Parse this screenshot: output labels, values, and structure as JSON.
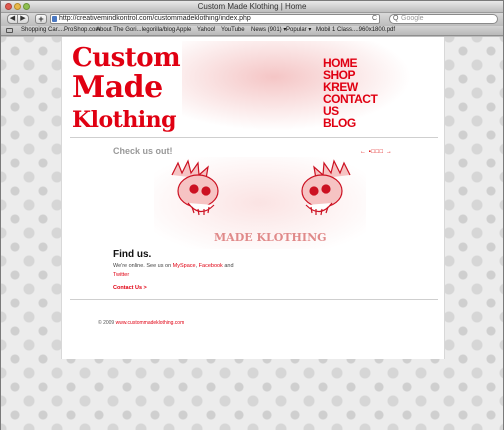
{
  "browser": {
    "window_title": "Custom Made Klothing | Home",
    "url": "http://creativemindkontrol.com/custommadeklothing/index.php",
    "search_placeholder": "Google",
    "back_label": "◀",
    "forward_label": "▶",
    "add_label": "+",
    "reload_label": "C",
    "search_icon": "Q",
    "bookmarks": [
      "Shopping Car....ProShop.com",
      "About The Gori...legorilla/blog",
      "Apple",
      "Yahoo!",
      "YouTube",
      "News (901) ▾",
      "Popular ▾",
      "Mobil 1 Class....960x1800.pdf"
    ]
  },
  "site": {
    "logo": {
      "line1": "Custom",
      "line2": "Made",
      "line3": "Klothing"
    },
    "nav": [
      "HOME",
      "SHOP",
      "KREW",
      "CONTACT",
      "US",
      "BLOG"
    ],
    "featured": {
      "heading": "Check us out!",
      "slider_controls": "←  ▪□□□  →",
      "banner_text": "MADE KLOTHING"
    },
    "find_us": {
      "heading": "Find us.",
      "text_prefix": "We're online. See us on",
      "myspace": "MySpace",
      "facebook": "Facebook",
      "and": "and",
      "twitter": "Twitter",
      "contact_link": "Contact Us >"
    },
    "footer": {
      "copyright": "© 2009",
      "link": "www.custommadeklothing.com"
    }
  },
  "colors": {
    "brand_red": "#e00012",
    "heading_gray": "#999999"
  }
}
